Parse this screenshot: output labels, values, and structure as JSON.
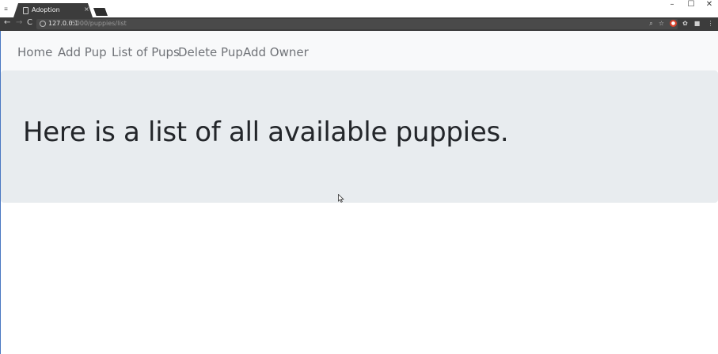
{
  "browser": {
    "tab_title": "Adoption",
    "tab_close": "×",
    "url_host": "127.0.0.1",
    "url_path": ":5000/puppies/list",
    "window_controls": {
      "minimize": "–",
      "maximize": "☐",
      "close": "✕"
    },
    "nav": {
      "back": "←",
      "forward": "→",
      "reload": "C"
    },
    "icons": [
      "zoom-icon",
      "star-icon",
      "extension-red-icon",
      "extension-gear-icon",
      "extension-dark-icon",
      "menu-dots-icon"
    ]
  },
  "navbar": {
    "links": [
      "Home",
      "Add Pup",
      "List of Pups",
      "Delete Pup",
      "Add Owner"
    ]
  },
  "jumbotron": {
    "heading": "Here is a list of all available puppies."
  },
  "colors": {
    "navbar_bg": "#f8f9fa",
    "jumbotron_bg": "#e8ecef",
    "heading_text": "#23262a",
    "nav_link_text": "#707378"
  }
}
